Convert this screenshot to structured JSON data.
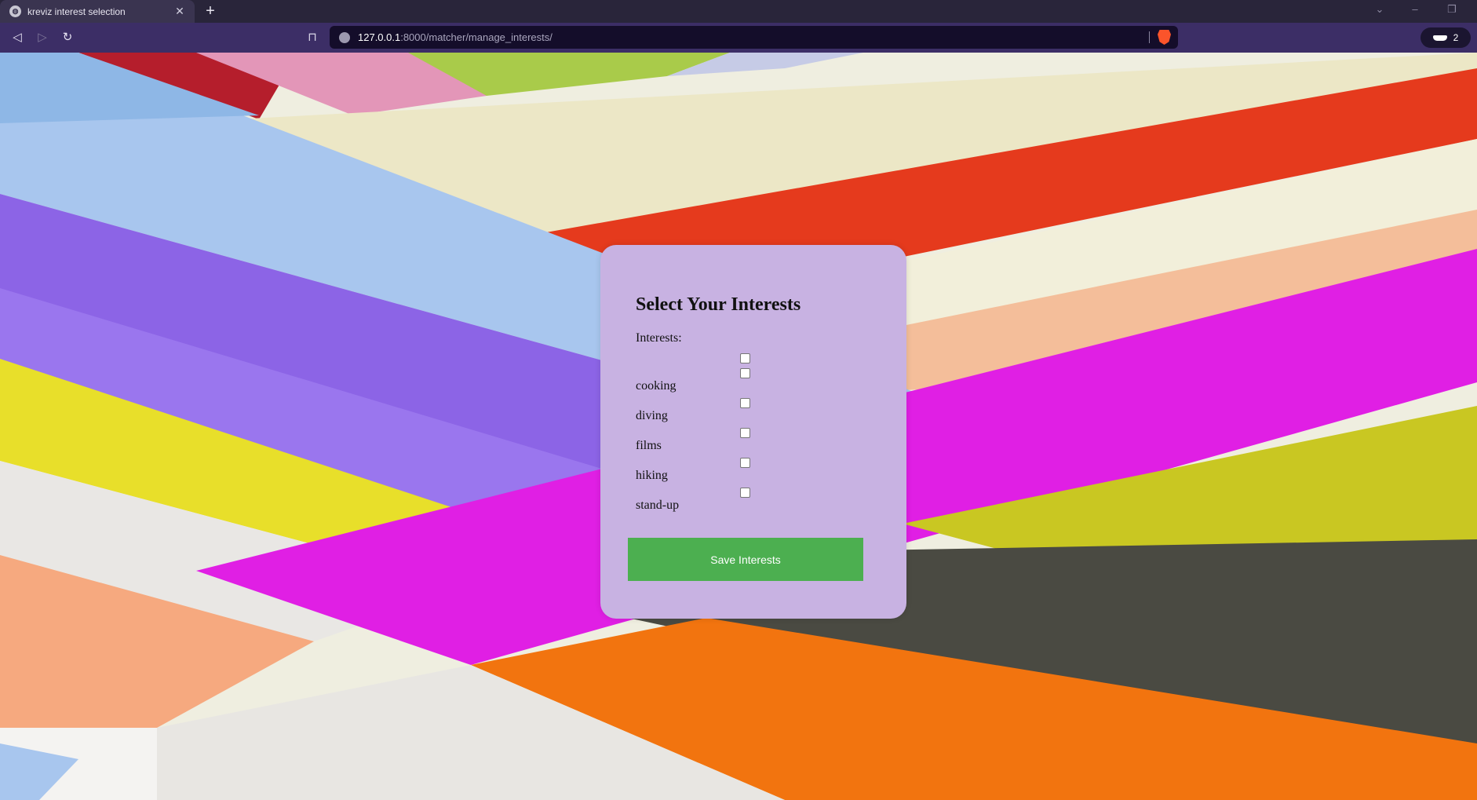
{
  "browser": {
    "tab_title": "kreviz interest selection",
    "url_host": "127.0.0.1",
    "url_rest": ":8000/matcher/manage_interests/",
    "profile_count": "2"
  },
  "form": {
    "title": "Select Your Interests",
    "interests_label": "Interests:",
    "options": [
      "cooking",
      "diving",
      "films",
      "hiking",
      "stand-up"
    ],
    "save_label": "Save Interests"
  },
  "colors": {
    "card": "#c8b2e2",
    "button": "#4caf50"
  }
}
